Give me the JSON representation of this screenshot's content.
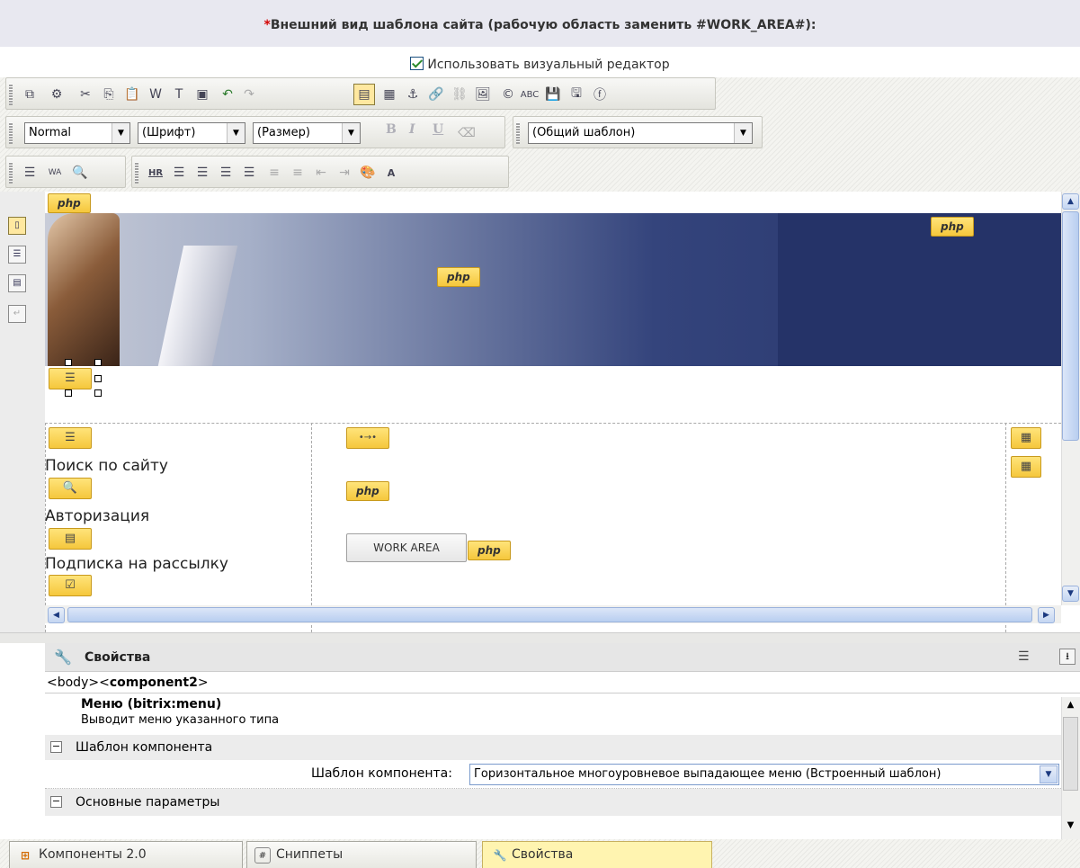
{
  "header": {
    "required_mark": "*",
    "title": "Внешний вид шаблона сайта (рабочую область заменить #WORK_AREA#):"
  },
  "visual_editor": {
    "label": "Использовать визуальный редактор",
    "checked": true
  },
  "toolbar2": {
    "style_select": "Normal",
    "font_select": "(Шрифт)",
    "size_select": "(Размер)",
    "template_select": "(Общий шаблон)",
    "bold": "B",
    "italic": "I",
    "underline": "U"
  },
  "toolbar3": {
    "hr_label": "HR",
    "wa_label": "WA"
  },
  "editor": {
    "php_label": "php",
    "sidebar_texts": [
      "Поиск по сайту",
      "Авторизация",
      "Подписка на рассылку"
    ],
    "work_area_label": "WORK AREA",
    "breadcrumb_arrow": "•→•"
  },
  "properties": {
    "title": "Свойства",
    "path_prefix": "<body><",
    "path_tag": "component2",
    "path_suffix": ">",
    "component_name": "Меню (bitrix:menu)",
    "component_desc": "Выводит меню указанного типа",
    "group1": "Шаблон компонента",
    "param_label": "Шаблон компонента:",
    "param_value": "Горизонтальное многоуровневое выпадающее меню (Встроенный шаблон)",
    "group2": "Основные параметры"
  },
  "tabs": [
    {
      "label": "Компоненты 2.0",
      "icon": "components-icon"
    },
    {
      "label": "Сниппеты",
      "icon": "snippets-icon"
    },
    {
      "label": "Свойства",
      "icon": "wrench-icon",
      "active": true
    }
  ],
  "colors": {
    "accent": "#f5c73c",
    "required": "#d40000",
    "banner": "#253368"
  }
}
